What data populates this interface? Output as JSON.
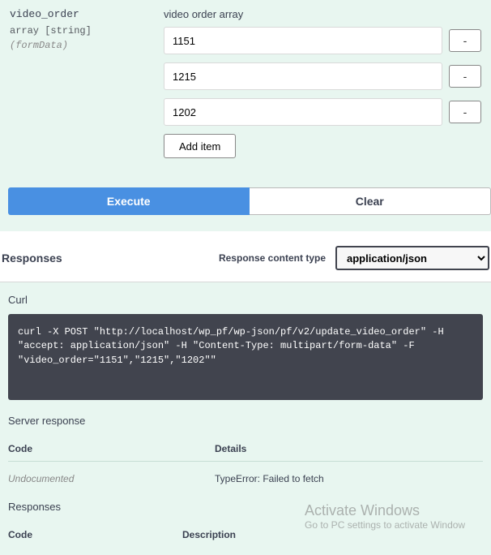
{
  "param": {
    "name": "video_order",
    "type": "array [string]",
    "in": "(formData)",
    "label": "video order array",
    "items": [
      "1151",
      "1215",
      "1202"
    ],
    "remove_label": "-",
    "add_label": "Add item"
  },
  "actions": {
    "execute": "Execute",
    "clear": "Clear"
  },
  "responses": {
    "heading": "Responses",
    "ct_label": "Response content type",
    "ct_value": "application/json"
  },
  "curl": {
    "heading": "Curl",
    "command": "curl -X POST \"http://localhost/wp_pf/wp-json/pf/v2/update_video_order\" -H \"accept: application/json\" -H \"Content-Type: multipart/form-data\" -F \"video_order=\"1151\",\"1215\",\"1202\"\""
  },
  "server_response": {
    "heading": "Server response",
    "th_code": "Code",
    "th_details": "Details",
    "code": "Undocumented",
    "details": "TypeError: Failed to fetch"
  },
  "responses2": {
    "heading": "Responses",
    "th_code": "Code",
    "th_desc": "Description"
  },
  "watermark": {
    "line1": "Activate Windows",
    "line2": "Go to PC settings to activate Window"
  }
}
